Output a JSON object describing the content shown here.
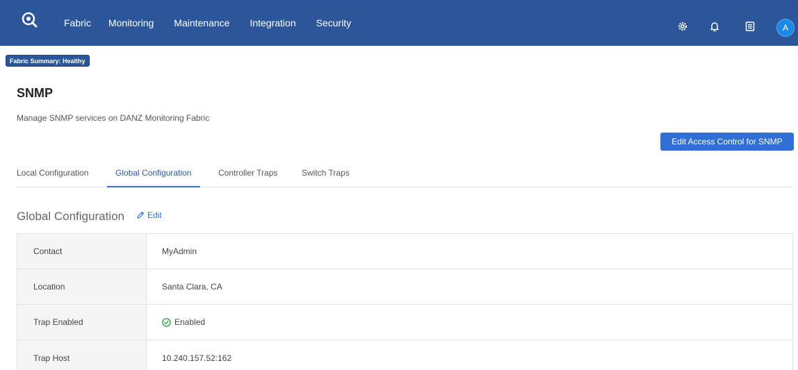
{
  "nav": {
    "items": [
      "Fabric",
      "Monitoring",
      "Maintenance",
      "Integration",
      "Security"
    ],
    "avatar_initial": "A",
    "logo_icon": "search-eye-logo-icon",
    "icons": [
      "gear-icon",
      "bell-icon",
      "document-icon"
    ]
  },
  "fabric_summary": "Fabric Summary: Healthy",
  "page": {
    "title": "SNMP",
    "subtitle": "Manage SNMP services on DANZ Monitoring Fabric",
    "action_button": "Edit Access Control for SNMP"
  },
  "tabs": [
    "Local Configuration",
    "Global Configuration",
    "Controller Traps",
    "Switch Traps"
  ],
  "active_tab": "Global Configuration",
  "section": {
    "title": "Global Configuration",
    "edit_label": "Edit"
  },
  "config": [
    {
      "label": "Contact",
      "value": "MyAdmin"
    },
    {
      "label": "Location",
      "value": "Santa Clara, CA"
    },
    {
      "label": "Trap Enabled",
      "value": "Enabled"
    },
    {
      "label": "Trap Host",
      "value": "10.240.157.52:162"
    }
  ],
  "colors": {
    "topbar": "#2b579a",
    "accent": "#2f6fd6",
    "enabled_green": "#2e9e44"
  }
}
